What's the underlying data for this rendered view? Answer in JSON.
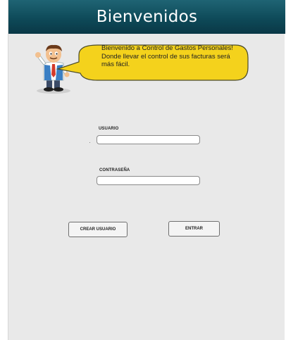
{
  "header": {
    "title": "Bienvenidos"
  },
  "welcome": {
    "mascot_icon": "cartoon-businessman-icon",
    "bubble_lines": [
      "Bienvenido a Control de Gastos Personales!",
      "Donde llevar el control de sus facturas será",
      "más fácil."
    ]
  },
  "login_form": {
    "username_label": "USUARIO",
    "username_value": "",
    "password_label": "CONTRASEÑA",
    "password_value": ""
  },
  "actions": {
    "create_user_label": "CREAR USUARIO",
    "enter_label": "ENTRAR"
  },
  "colors": {
    "header_bg": "#0e4a59",
    "window_bg": "#e9e9e9",
    "bubble_fill": "#f4d21c",
    "bubble_stroke": "#4a4a2a"
  }
}
